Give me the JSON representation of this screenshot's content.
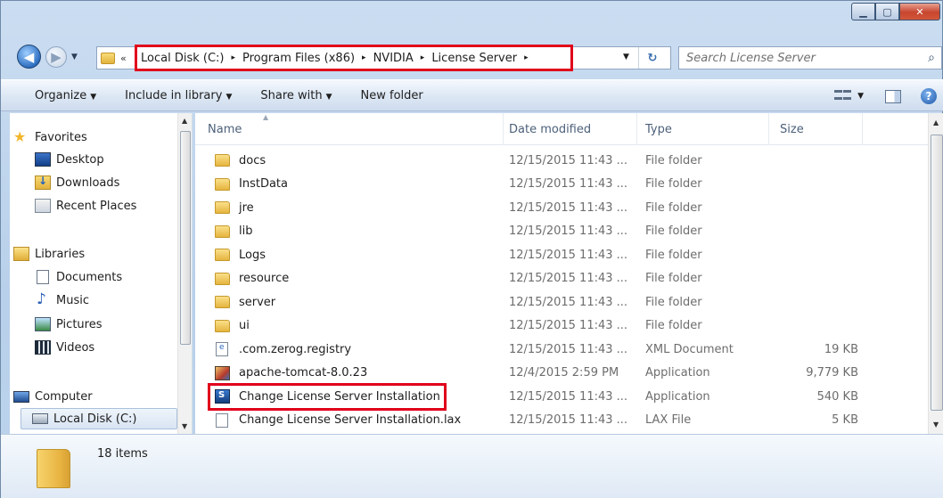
{
  "window": {
    "min": "▁",
    "max": "▢",
    "close": "✕"
  },
  "address": {
    "overflow": "«",
    "crumbs": [
      "Local Disk (C:)",
      "Program Files (x86)",
      "NVIDIA",
      "License Server"
    ],
    "separator": "▸",
    "search_placeholder": "Search License Server"
  },
  "commands": {
    "organize": "Organize",
    "include": "Include in library",
    "share": "Share with",
    "new_folder": "New folder"
  },
  "nav": {
    "favorites": "Favorites",
    "desktop": "Desktop",
    "downloads": "Downloads",
    "recent": "Recent Places",
    "libraries": "Libraries",
    "documents": "Documents",
    "music": "Music",
    "pictures": "Pictures",
    "videos": "Videos",
    "computer": "Computer",
    "local_disk": "Local Disk (C:)"
  },
  "columns": {
    "name": "Name",
    "date": "Date modified",
    "type": "Type",
    "size": "Size"
  },
  "files": [
    {
      "name": "docs",
      "date": "12/15/2015 11:43 ...",
      "type": "File folder",
      "size": ""
    },
    {
      "name": "InstData",
      "date": "12/15/2015 11:43 ...",
      "type": "File folder",
      "size": ""
    },
    {
      "name": "jre",
      "date": "12/15/2015 11:43 ...",
      "type": "File folder",
      "size": ""
    },
    {
      "name": "lib",
      "date": "12/15/2015 11:43 ...",
      "type": "File folder",
      "size": ""
    },
    {
      "name": "Logs",
      "date": "12/15/2015 11:43 ...",
      "type": "File folder",
      "size": ""
    },
    {
      "name": "resource",
      "date": "12/15/2015 11:43 ...",
      "type": "File folder",
      "size": ""
    },
    {
      "name": "server",
      "date": "12/15/2015 11:43 ...",
      "type": "File folder",
      "size": ""
    },
    {
      "name": "ui",
      "date": "12/15/2015 11:43 ...",
      "type": "File folder",
      "size": ""
    },
    {
      "name": ".com.zerog.registry",
      "date": "12/15/2015 11:43 ...",
      "type": "XML Document",
      "size": "19 KB"
    },
    {
      "name": "apache-tomcat-8.0.23",
      "date": "12/4/2015 2:59 PM",
      "type": "Application",
      "size": "9,779 KB"
    },
    {
      "name": "Change License Server Installation",
      "date": "12/15/2015 11:43 ...",
      "type": "Application",
      "size": "540 KB"
    },
    {
      "name": "Change License Server Installation.lax",
      "date": "12/15/2015 11:43 ...",
      "type": "LAX File",
      "size": "5 KB"
    }
  ],
  "status": {
    "item_count": "18 items"
  },
  "colors": {
    "highlight": "#e0001b",
    "window_frame": "#bcd3ec",
    "folder": "#e5b43f"
  },
  "icons": {
    "dropdown": "▼",
    "search": "⌕",
    "refresh": "↻",
    "help": "?"
  }
}
